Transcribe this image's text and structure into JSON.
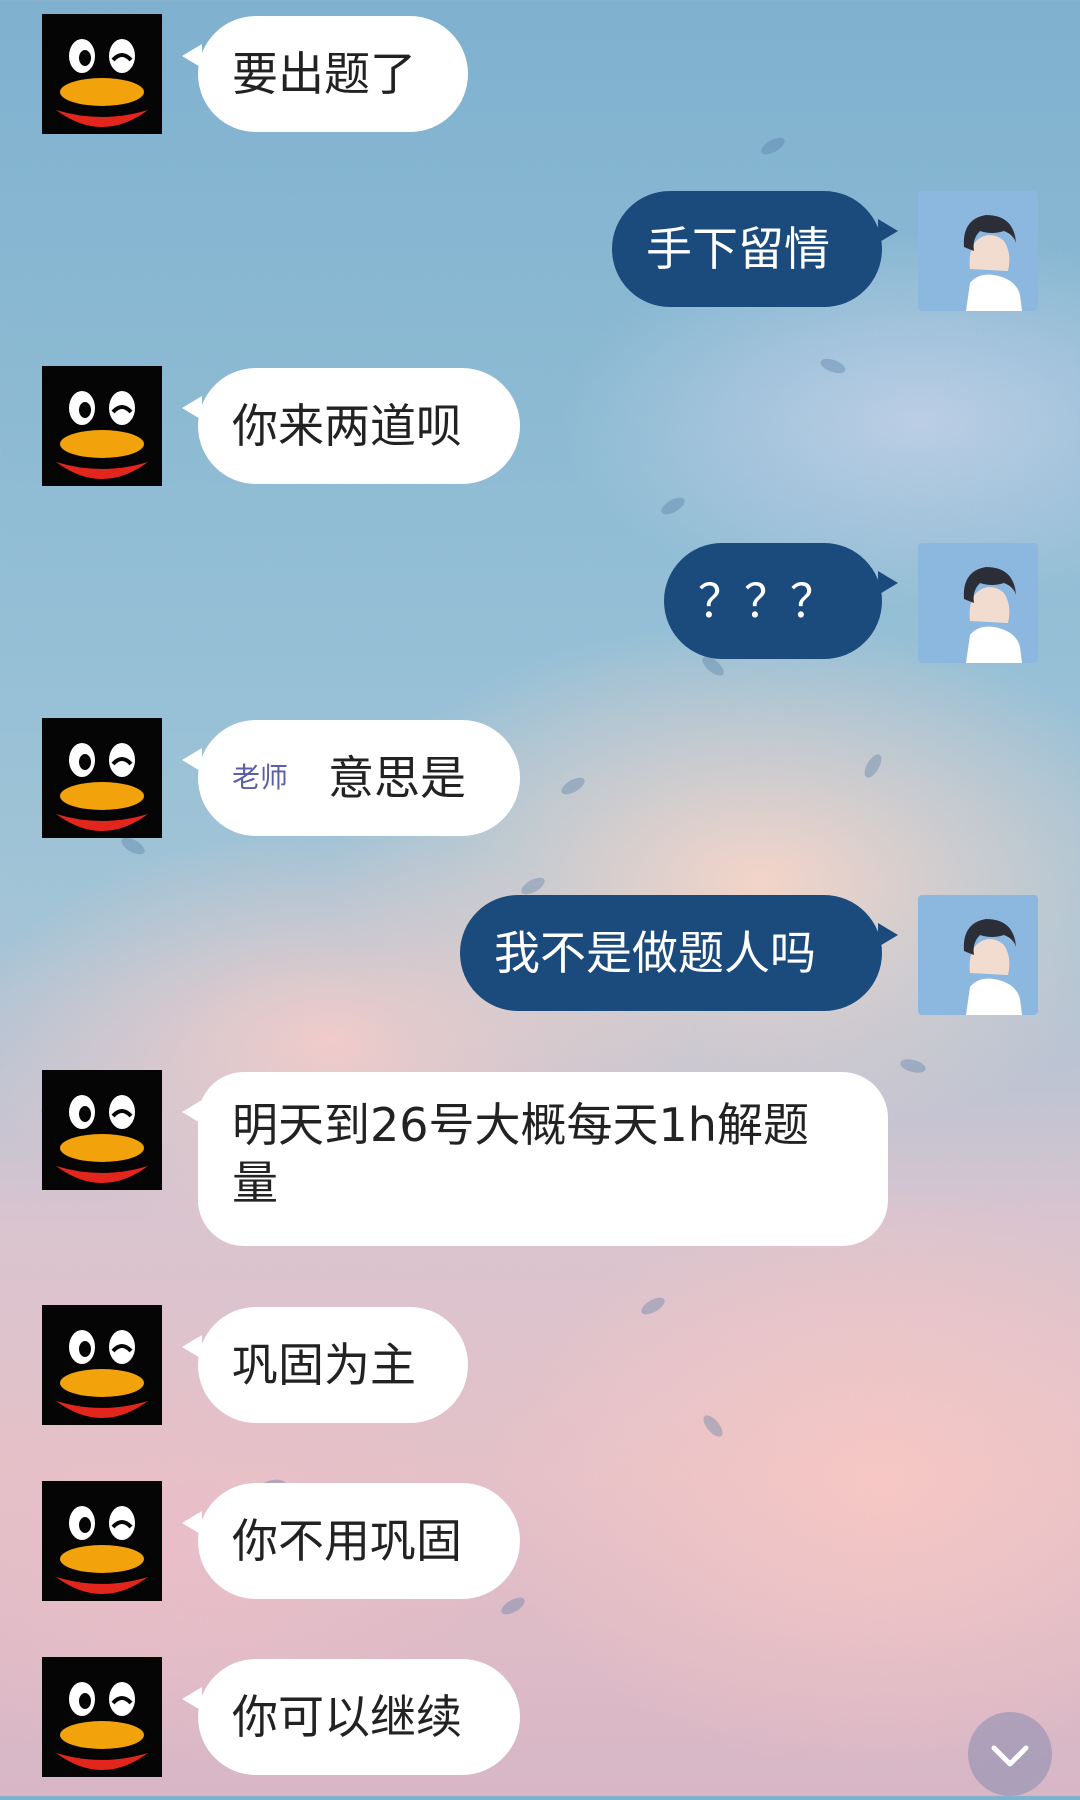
{
  "chat": {
    "messages": [
      {
        "side": "in",
        "text": "要出题了"
      },
      {
        "side": "out",
        "text": "手下留情"
      },
      {
        "side": "in",
        "text": "你来两道呗"
      },
      {
        "side": "out",
        "text": "？？？"
      },
      {
        "side": "in",
        "badge": "老师",
        "text": "意思是"
      },
      {
        "side": "out",
        "text": "我不是做题人吗"
      },
      {
        "side": "in",
        "text": "明天到26号大概每天1h解题量"
      },
      {
        "side": "in",
        "text": "巩固为主"
      },
      {
        "side": "in",
        "text": "你不用巩固"
      },
      {
        "side": "in",
        "text": "你可以继续"
      }
    ]
  },
  "icons": {
    "contact_avatar": "qq-penguin-icon",
    "self_avatar": "user-photo-avatar",
    "scroll": "chevron-down-icon"
  },
  "colors": {
    "incoming_bubble": "#ffffff",
    "outgoing_bubble": "#1b4a7d",
    "badge_text": "#5b5fa8"
  }
}
